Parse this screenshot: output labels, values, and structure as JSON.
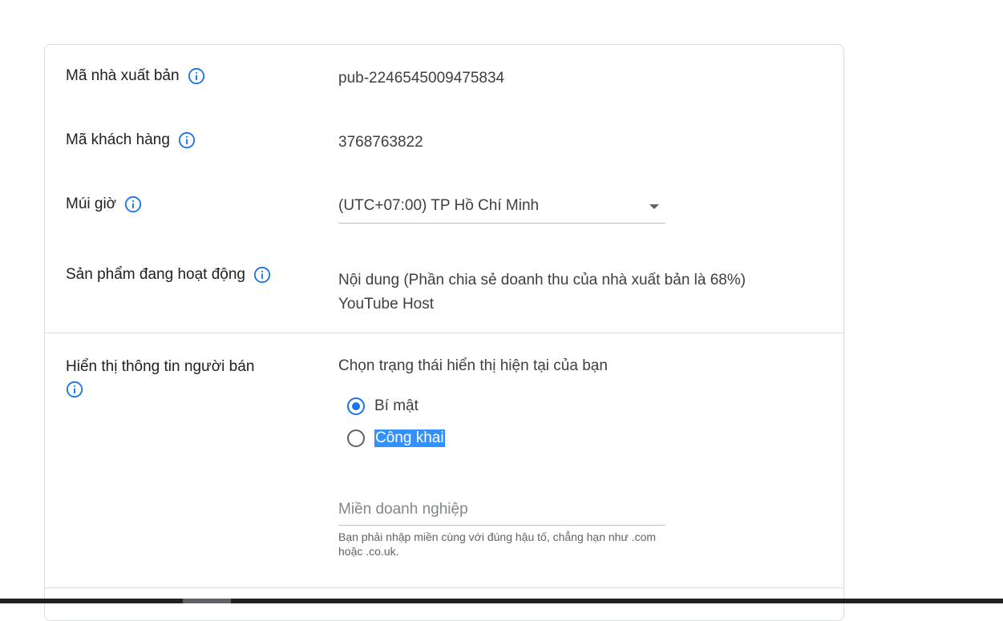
{
  "account": {
    "publisher_id": {
      "label": "Mã nhà xuất bản",
      "value": "pub-2246545009475834",
      "icon": "info-icon"
    },
    "customer_id": {
      "label": "Mã khách hàng",
      "value": "3768763822",
      "icon": "info-icon"
    },
    "timezone": {
      "label": "Múi giờ",
      "selected": "(UTC+07:00) TP Hồ Chí Minh",
      "icon": "info-icon"
    },
    "active_products": {
      "label": "Sản phẩm đang hoạt động",
      "line1": "Nội dung (Phần chia sẻ doanh thu của nhà xuất bản là 68%)",
      "line2": "YouTube Host",
      "icon": "info-icon"
    }
  },
  "seller_info": {
    "label": "Hiển thị thông tin người bán",
    "icon": "info-icon",
    "prompt": "Chọn trạng thái hiển thị hiện tại của bạn",
    "options": [
      {
        "label": "Bí mật",
        "checked": true
      },
      {
        "label": "Công khai",
        "checked": false
      }
    ],
    "domain_field": {
      "placeholder": "Miền doanh nghiệp",
      "value": "",
      "hint": "Bạn phải nhập miền cùng với đúng hậu tố, chẳng hạn như .com hoặc .co.uk."
    }
  },
  "colors": {
    "accent": "#1a73e8",
    "text_selection": "#3390ff",
    "divider": "#dadce0"
  }
}
